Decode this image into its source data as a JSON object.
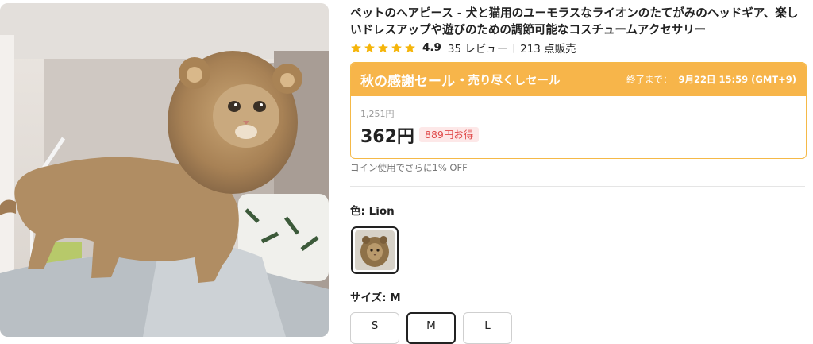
{
  "product": {
    "title": "ペットのヘアピース - 犬と猫用のユーモラスなライオンのたてがみのヘッドギア、楽しいドレスアップや遊びのための調節可能なコスチュームアクセサリー",
    "rating": "4.9",
    "stars_filled": 5,
    "review_count": "35 レビュー",
    "sold_count": "213 点販売",
    "image_icon": "lion-mane-cat-photo"
  },
  "sale": {
    "title": "秋の感謝セール",
    "subtitle": "・売り尽くしセール",
    "countdown_label": "終了まで：",
    "countdown_value": "9月22日 15:59 (GMT+9)",
    "banner_color": "#f7b54a"
  },
  "price": {
    "original": "1,251円",
    "current": "362円",
    "savings": "889円お得"
  },
  "coin_note": "コイン使用でさらに1% OFF",
  "color": {
    "label": "色: Lion",
    "swatch_icon": "lion-mane-thumbnail"
  },
  "size": {
    "label": "サイズ: M",
    "options": [
      "S",
      "M",
      "L"
    ],
    "selected": "M"
  }
}
